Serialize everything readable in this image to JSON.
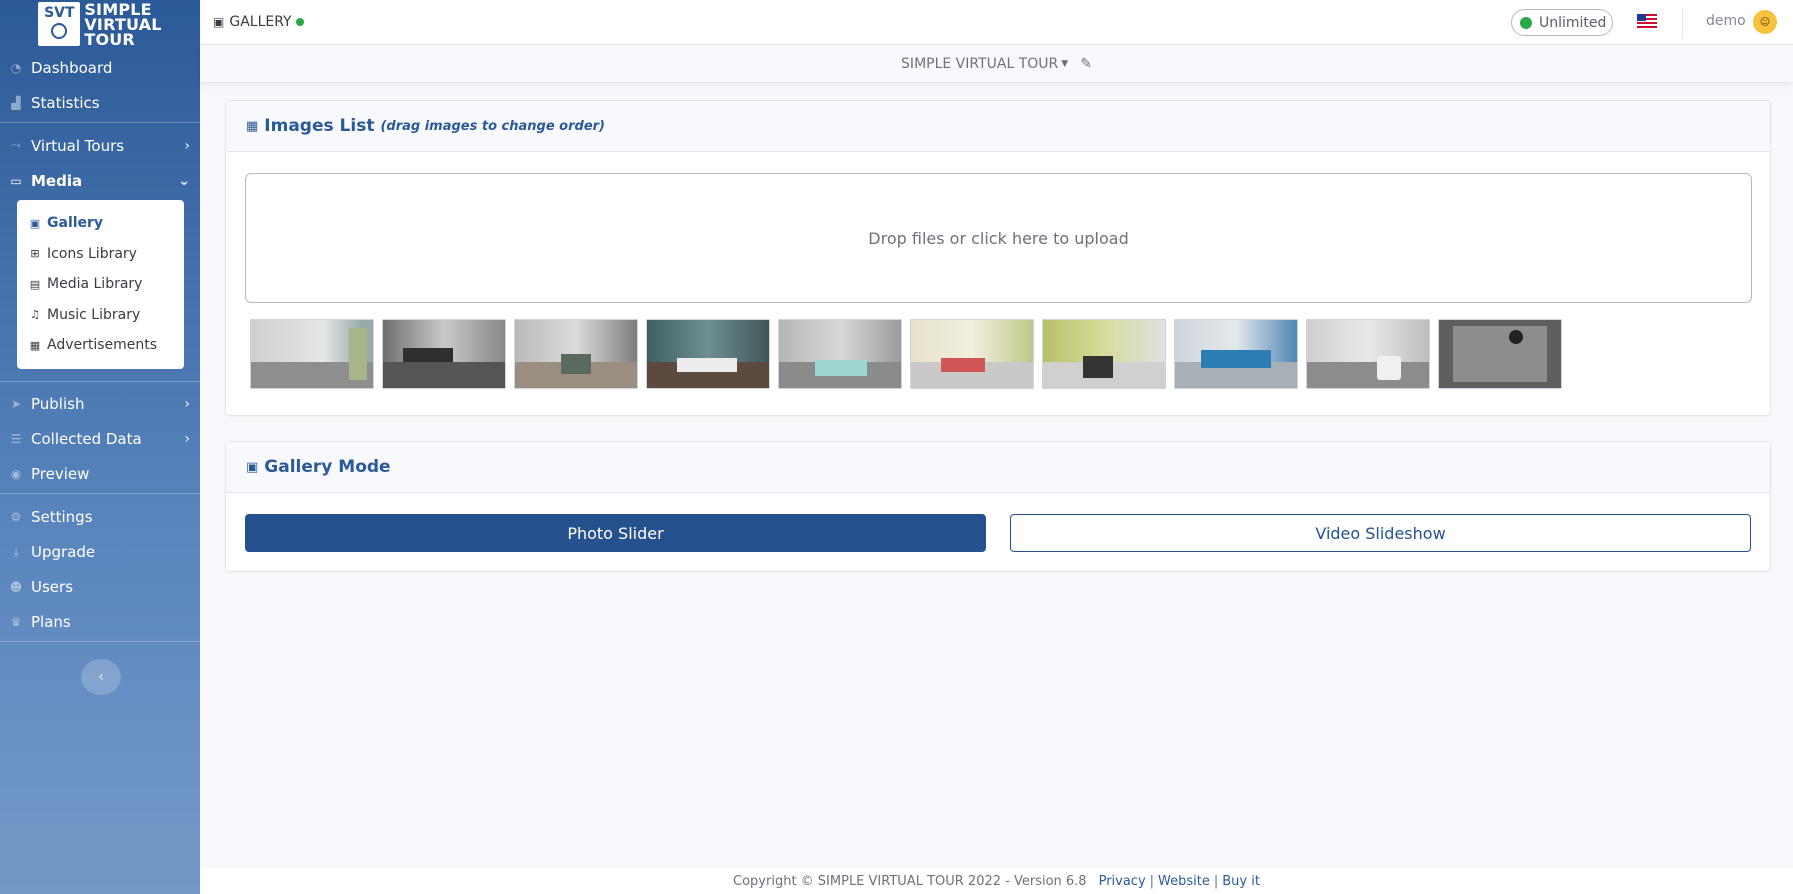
{
  "brand": {
    "logo_text": "SVT",
    "title_line1": "SIMPLE",
    "title_line2": "VIRTUAL",
    "title_line3": "TOUR"
  },
  "sidebar": {
    "items": [
      {
        "label": "Dashboard",
        "icon": "dashboard-icon"
      },
      {
        "label": "Statistics",
        "icon": "chart-icon"
      },
      {
        "label": "Virtual Tours",
        "icon": "route-icon"
      },
      {
        "label": "Media",
        "icon": "desktop-icon"
      },
      {
        "label": "Publish",
        "icon": "paper-plane-icon"
      },
      {
        "label": "Collected Data",
        "icon": "database-icon"
      },
      {
        "label": "Preview",
        "icon": "eye-icon"
      },
      {
        "label": "Settings",
        "icon": "cogs-icon"
      },
      {
        "label": "Upgrade",
        "icon": "download-icon"
      },
      {
        "label": "Users",
        "icon": "users-icon"
      },
      {
        "label": "Plans",
        "icon": "crown-icon"
      }
    ],
    "media_submenu": [
      {
        "label": "Gallery",
        "icon": "images-icon"
      },
      {
        "label": "Icons Library",
        "icon": "icons-icon"
      },
      {
        "label": "Media Library",
        "icon": "photo-video-icon"
      },
      {
        "label": "Music Library",
        "icon": "music-icon"
      },
      {
        "label": "Advertisements",
        "icon": "ad-icon"
      }
    ]
  },
  "topbar": {
    "page_title": "GALLERY",
    "plan_label": "Unlimited",
    "username": "demo"
  },
  "tourbar": {
    "tour_name": "SIMPLE VIRTUAL TOUR"
  },
  "images_card": {
    "title": "Images List",
    "hint": "(drag images to change order)",
    "dropzone_text": "Drop files or click here to upload",
    "thumbnail_count": 10
  },
  "mode_card": {
    "title": "Gallery Mode",
    "photo_slider_label": "Photo Slider",
    "video_slideshow_label": "Video Slideshow"
  },
  "footer": {
    "copyright": "Copyright © SIMPLE VIRTUAL TOUR 2022 - Version 6.8",
    "privacy": "Privacy",
    "website": "Website",
    "buy": "Buy it"
  },
  "colors": {
    "primary": "#25528f",
    "sidebar_top": "#2b5a98",
    "status_green": "#28a745"
  }
}
